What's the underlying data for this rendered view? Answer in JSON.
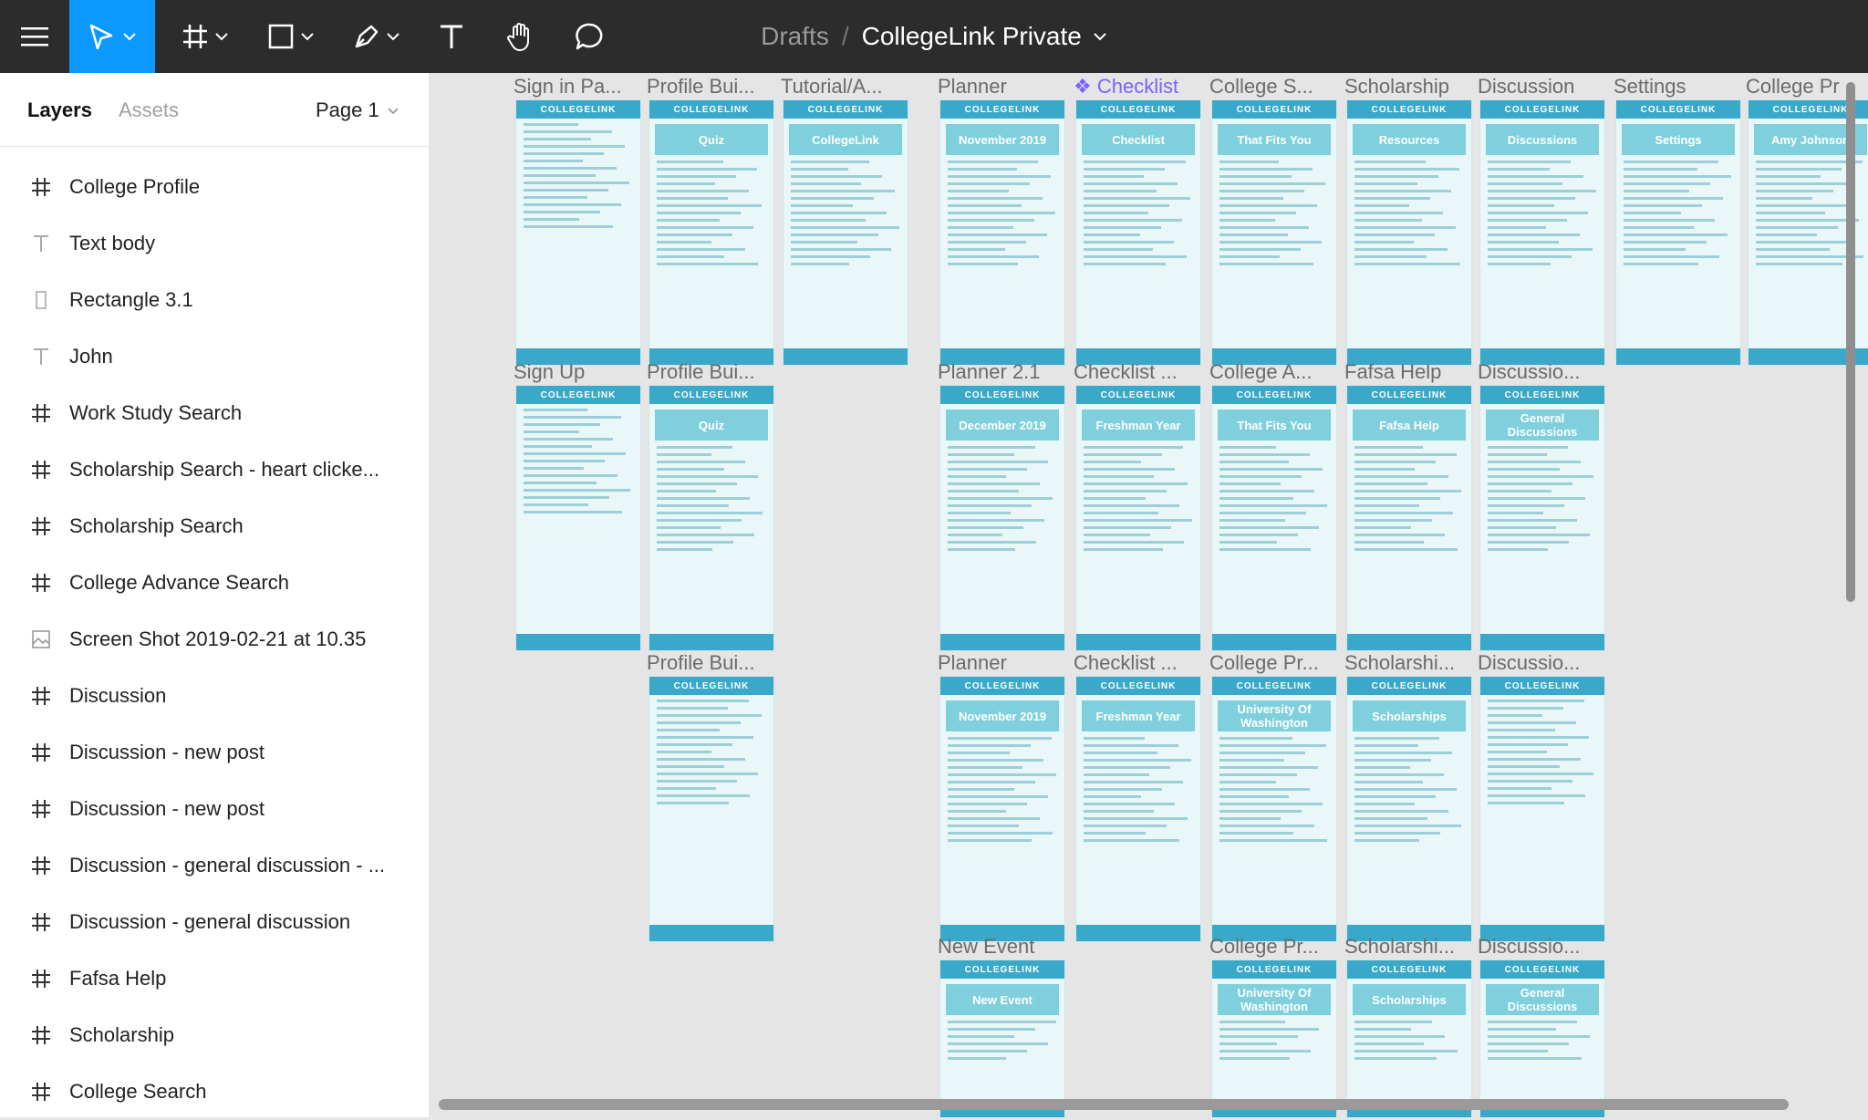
{
  "topbar": {
    "breadcrumb_parent": "Drafts",
    "separator": "/",
    "file_name": "CollegeLink Private",
    "bg_color": "#2c2c2c",
    "active_tool_color": "#0d99ff"
  },
  "sidebar": {
    "tabs": {
      "layers": "Layers",
      "assets": "Assets"
    },
    "page_selector": "Page 1",
    "layers": [
      {
        "icon": "frame-icon",
        "label": "College Profile"
      },
      {
        "icon": "text-icon",
        "label": "Text body"
      },
      {
        "icon": "rectangle-icon",
        "label": "Rectangle 3.1"
      },
      {
        "icon": "text-icon",
        "label": "John"
      },
      {
        "icon": "frame-icon",
        "label": "Work Study Search"
      },
      {
        "icon": "frame-icon",
        "label": "Scholarship Search - heart clicke..."
      },
      {
        "icon": "frame-icon",
        "label": "Scholarship Search"
      },
      {
        "icon": "frame-icon",
        "label": "College Advance Search"
      },
      {
        "icon": "image-icon",
        "label": "Screen Shot 2019-02-21 at 10.35"
      },
      {
        "icon": "frame-icon",
        "label": "Discussion"
      },
      {
        "icon": "frame-icon",
        "label": "Discussion - new post"
      },
      {
        "icon": "frame-icon",
        "label": "Discussion - new post"
      },
      {
        "icon": "frame-icon",
        "label": "Discussion - general discussion - ..."
      },
      {
        "icon": "frame-icon",
        "label": "Discussion - general discussion"
      },
      {
        "icon": "frame-icon",
        "label": "Fafsa Help"
      },
      {
        "icon": "frame-icon",
        "label": "Scholarship"
      },
      {
        "icon": "frame-icon",
        "label": "College Search"
      }
    ]
  },
  "canvas": {
    "app_header": "COLLEGELINK",
    "frames": [
      {
        "label": "Sign in Pa...",
        "title": ""
      },
      {
        "label": "Profile Bui...",
        "title": "Quiz"
      },
      {
        "label": "Tutorial/A...",
        "title": "CollegeLink"
      },
      {
        "label": "Planner",
        "title": "November 2019"
      },
      {
        "label": "Checklist",
        "title": "Checklist"
      },
      {
        "label": "College S...",
        "title": "That Fits You"
      },
      {
        "label": "Scholarship",
        "title": "Resources"
      },
      {
        "label": "Discussion",
        "title": "Discussions"
      },
      {
        "label": "Settings",
        "title": "Settings"
      },
      {
        "label": "College Pr",
        "title": "Amy Johnson"
      },
      {
        "label": "Sign Up",
        "title": ""
      },
      {
        "label": "Profile Bui...",
        "title": "Quiz"
      },
      {
        "label": "Planner 2.1",
        "title": "December 2019"
      },
      {
        "label": "Checklist ...",
        "title": "Freshman Year"
      },
      {
        "label": "College A...",
        "title": "That Fits You"
      },
      {
        "label": "Fafsa Help",
        "title": "Fafsa Help"
      },
      {
        "label": "Discussio...",
        "title": "General Discussions"
      },
      {
        "label": "Profile Bui...",
        "title": ""
      },
      {
        "label": "Planner",
        "title": "November 2019"
      },
      {
        "label": "Checklist ...",
        "title": "Freshman Year"
      },
      {
        "label": "College Pr...",
        "title": "University Of Washington"
      },
      {
        "label": "Scholarshi...",
        "title": "Scholarships"
      },
      {
        "label": "Discussio...",
        "title": ""
      },
      {
        "label": "New Event",
        "title": "New Event"
      },
      {
        "label": "College Pr...",
        "title": "University Of Washington"
      },
      {
        "label": "Scholarshi...",
        "title": "Scholarships"
      },
      {
        "label": "Discussio...",
        "title": "General Discussions"
      }
    ]
  }
}
